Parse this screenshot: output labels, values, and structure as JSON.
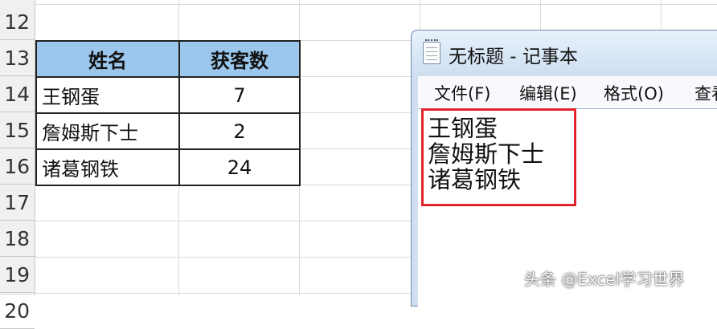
{
  "sheet": {
    "row_numbers": [
      "12",
      "13",
      "14",
      "15",
      "16",
      "17",
      "18",
      "19",
      "20"
    ],
    "table": {
      "headers": [
        "姓名",
        "获客数"
      ],
      "rows": [
        {
          "name": "王钢蛋",
          "count": "7"
        },
        {
          "name": "詹姆斯下士",
          "count": "2"
        },
        {
          "name": "诸葛钢铁",
          "count": "24"
        }
      ]
    },
    "header_fill_color": "#9bc7ec"
  },
  "notepad": {
    "title": "无标题 - 记事本",
    "menu": [
      "文件(F)",
      "编辑(E)",
      "格式(O)",
      "查看"
    ],
    "lines": [
      "王钢蛋",
      "詹姆斯下士",
      "诸葛钢铁"
    ],
    "highlight_color": "#e0242c"
  },
  "watermark": "头条 @Excel学习世界"
}
